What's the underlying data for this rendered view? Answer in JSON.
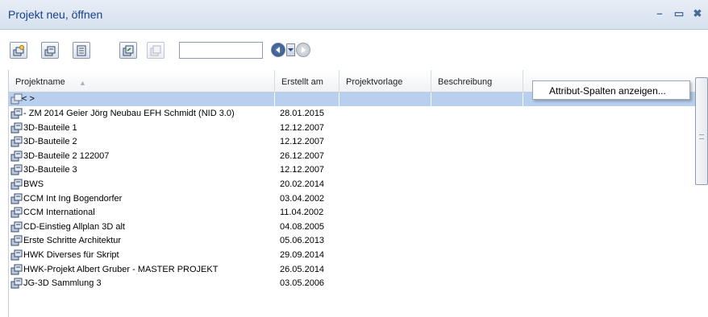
{
  "window": {
    "title": "Projekt neu, öffnen",
    "minimize_glyph": "–",
    "maximize_glyph": "▭",
    "close_glyph": "✖"
  },
  "toolbar": {
    "buttons": [
      {
        "icon": "new-project-icon"
      },
      {
        "icon": "open-project-icon"
      },
      {
        "icon": "properties-icon"
      },
      {
        "icon": "copy-project-icon"
      },
      {
        "icon": "delete-project-icon"
      }
    ],
    "search_value": "",
    "nav": {
      "back_icon": "back-arrow-icon",
      "dropdown_icon": "chevron-down-icon",
      "forward_icon": "forward-arrow-icon"
    }
  },
  "table": {
    "columns": [
      "Projektname",
      "Erstellt am",
      "Projektvorlage",
      "Beschreibung"
    ],
    "selected_row": {
      "name": "<     >",
      "created": "",
      "template": "",
      "description": ""
    },
    "rows": [
      {
        "name": "- ZM 2014 Geier Jörg Neubau EFH Schmidt (NID  3.0)",
        "created": "28.01.2015"
      },
      {
        "name": "3D-Bauteile 1",
        "created": "12.12.2007"
      },
      {
        "name": "3D-Bauteile 2",
        "created": "12.12.2007"
      },
      {
        "name": "3D-Bauteile 2 122007",
        "created": "26.12.2007"
      },
      {
        "name": "3D-Bauteile 3",
        "created": "12.12.2007"
      },
      {
        "name": "BWS",
        "created": "20.02.2014"
      },
      {
        "name": "CCM Int Ing Bogendorfer",
        "created": "03.04.2002"
      },
      {
        "name": "CCM International",
        "created": "11.04.2002"
      },
      {
        "name": "CD-Einstieg Allplan 3D alt",
        "created": "04.08.2005"
      },
      {
        "name": "Erste Schritte Architektur",
        "created": "05.06.2013"
      },
      {
        "name": "HWK Diverses für Skript",
        "created": "29.09.2014"
      },
      {
        "name": "HWK-Projekt Albert Gruber - MASTER PROJEKT",
        "created": "26.05.2014"
      },
      {
        "name": "JG-3D Sammlung 3",
        "created": "03.05.2006"
      }
    ]
  },
  "context_menu": {
    "items": [
      "Attribut-Spalten anzeigen..."
    ]
  }
}
